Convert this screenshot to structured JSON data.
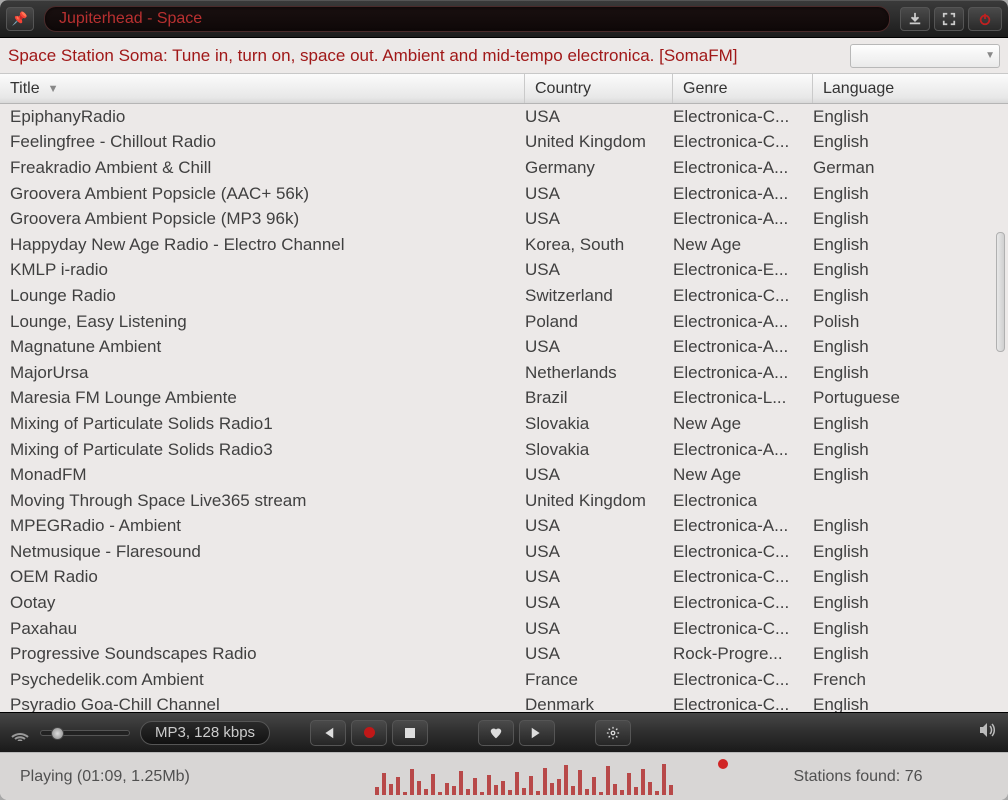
{
  "title": "Jupiterhead - Space",
  "status_text": "Space Station Soma: Tune in, turn on, space out. Ambient and mid-tempo electronica. [SomaFM]",
  "codec": "MP3, 128 kbps",
  "playing_label": "Playing (01:09, 1.25Mb)",
  "stations_label": "Stations found: 76",
  "columns": {
    "title": "Title",
    "country": "Country",
    "genre": "Genre",
    "language": "Language"
  },
  "eq_bars": [
    8,
    22,
    11,
    18,
    3,
    26,
    14,
    6,
    21,
    3,
    12,
    9,
    24,
    6,
    17,
    3,
    20,
    10,
    14,
    5,
    23,
    7,
    19,
    4,
    27,
    12,
    16,
    30,
    9,
    25,
    6,
    18,
    3,
    29,
    11,
    5,
    22,
    8,
    26,
    13,
    4,
    31,
    10
  ],
  "rows": [
    {
      "title": "EpiphanyRadio",
      "country": "USA",
      "genre": "Electronica-C...",
      "language": "English"
    },
    {
      "title": "Feelingfree - Chillout Radio",
      "country": "United Kingdom",
      "genre": "Electronica-C...",
      "language": "English"
    },
    {
      "title": "Freakradio Ambient & Chill",
      "country": "Germany",
      "genre": "Electronica-A...",
      "language": "German"
    },
    {
      "title": "Groovera Ambient Popsicle (AAC+ 56k)",
      "country": "USA",
      "genre": "Electronica-A...",
      "language": "English"
    },
    {
      "title": "Groovera Ambient Popsicle (MP3 96k)",
      "country": "USA",
      "genre": "Electronica-A...",
      "language": "English"
    },
    {
      "title": "Happyday New Age Radio - Electro Channel",
      "country": "Korea, South",
      "genre": "New Age",
      "language": "English"
    },
    {
      "title": "KMLP i-radio",
      "country": "USA",
      "genre": "Electronica-E...",
      "language": "English"
    },
    {
      "title": "Lounge Radio",
      "country": "Switzerland",
      "genre": "Electronica-C...",
      "language": "English"
    },
    {
      "title": "Lounge, Easy Listening",
      "country": "Poland",
      "genre": "Electronica-A...",
      "language": "Polish"
    },
    {
      "title": "Magnatune Ambient",
      "country": "USA",
      "genre": "Electronica-A...",
      "language": "English"
    },
    {
      "title": "MajorUrsa",
      "country": "Netherlands",
      "genre": "Electronica-A...",
      "language": "English"
    },
    {
      "title": "Maresia FM Lounge Ambiente",
      "country": "Brazil",
      "genre": "Electronica-L...",
      "language": "Portuguese"
    },
    {
      "title": "Mixing of Particulate Solids Radio1",
      "country": "Slovakia",
      "genre": "New Age",
      "language": "English"
    },
    {
      "title": "Mixing of Particulate Solids Radio3",
      "country": "Slovakia",
      "genre": "Electronica-A...",
      "language": "English"
    },
    {
      "title": "MonadFM",
      "country": "USA",
      "genre": "New Age",
      "language": "English"
    },
    {
      "title": "Moving Through Space Live365 stream",
      "country": "United Kingdom",
      "genre": "Electronica",
      "language": ""
    },
    {
      "title": "MPEGRadio - Ambient",
      "country": "USA",
      "genre": "Electronica-A...",
      "language": "English"
    },
    {
      "title": "Netmusique - Flaresound",
      "country": "USA",
      "genre": "Electronica-C...",
      "language": "English"
    },
    {
      "title": "OEM Radio",
      "country": "USA",
      "genre": "Electronica-C...",
      "language": "English"
    },
    {
      "title": "Ootay",
      "country": "USA",
      "genre": "Electronica-C...",
      "language": "English"
    },
    {
      "title": "Paxahau",
      "country": "USA",
      "genre": "Electronica-C...",
      "language": "English"
    },
    {
      "title": "Progressive Soundscapes Radio",
      "country": "USA",
      "genre": "Rock-Progre...",
      "language": "English"
    },
    {
      "title": "Psychedelik.com Ambient",
      "country": "France",
      "genre": "Electronica-C...",
      "language": "French"
    },
    {
      "title": "Psyradio Goa-Chill Channel",
      "country": "Denmark",
      "genre": "Electronica-C...",
      "language": "English"
    }
  ]
}
